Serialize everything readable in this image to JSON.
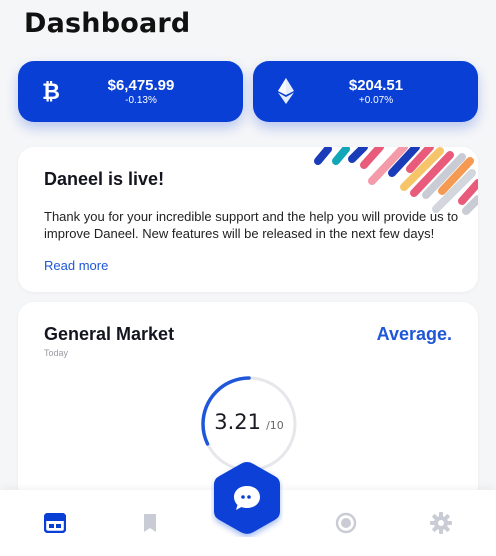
{
  "header": {
    "title": "Dashboard"
  },
  "coins": [
    {
      "name": "bitcoin",
      "icon": "bitcoin-icon",
      "price": "$6,475.99",
      "change": "-0.13%"
    },
    {
      "name": "ethereum",
      "icon": "ethereum-icon",
      "price": "$204.51",
      "change": "+0.07%"
    }
  ],
  "news": {
    "title": "Daneel is live!",
    "body": "Thank you for your incredible support and the help you will provide us to improve Daneel. New features will be released in the next few days!",
    "link": "Read more"
  },
  "market": {
    "title": "General Market",
    "subtitle": "Today",
    "rating": "Average.",
    "score": "3.21",
    "score_max": "/10",
    "score_fraction": 0.321
  },
  "tabbar": {
    "items": [
      {
        "icon": "dashboard-icon",
        "active": true
      },
      {
        "icon": "bookmark-icon",
        "active": false
      },
      {
        "icon": "chat-icon",
        "active": false
      },
      {
        "icon": "radar-icon",
        "active": false
      },
      {
        "icon": "gear-icon",
        "active": false
      }
    ]
  },
  "colors": {
    "primary": "#0a3fd6",
    "link": "#1f57d8",
    "inactive": "#c9ccd4"
  }
}
